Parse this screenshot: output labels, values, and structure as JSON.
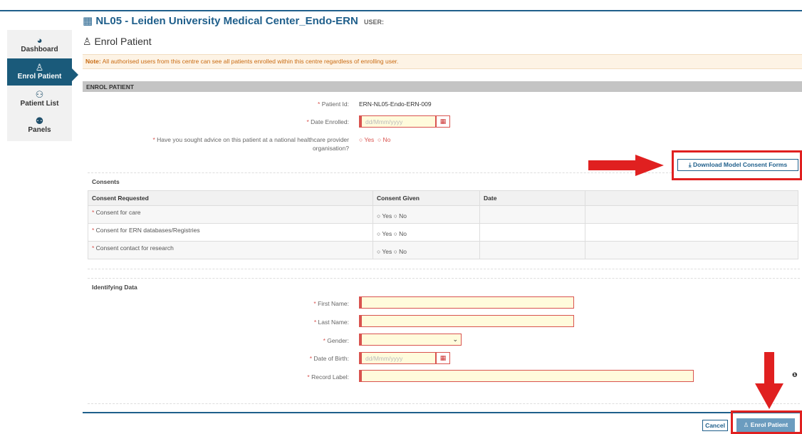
{
  "header": {
    "title": "NL05 - Leiden University Medical Center_Endo-ERN",
    "user_label": "USER:"
  },
  "sidebar": {
    "items": [
      {
        "label": "Dashboard",
        "icon": "dashboard-icon"
      },
      {
        "label": "Enrol Patient",
        "icon": "enrol-patient-icon",
        "active": true
      },
      {
        "label": "Patient List",
        "icon": "patient-list-icon"
      },
      {
        "label": "Panels",
        "icon": "panels-icon"
      }
    ]
  },
  "page": {
    "title": "Enrol Patient",
    "note_bold": "Note:",
    "note_text": "All authorised users from this centre can see all patients enrolled within this centre regardless of enrolling user.",
    "section_bar": "ENROL PATIENT"
  },
  "form": {
    "patient_id_label": "Patient Id:",
    "patient_id_value": "ERN-NL05-Endo-ERN-009",
    "date_enrolled_label": "Date Enrolled:",
    "date_placeholder": "dd/Mmm/yyyy",
    "advice_label_line1": "Have you sought advice on this patient at a national healthcare provider",
    "advice_label_line2": "organisation?",
    "yes": "Yes",
    "no": "No",
    "download_button": "Download Model Consent Forms"
  },
  "consents": {
    "section_title": "Consents",
    "columns": [
      "Consent Requested",
      "Consent Given",
      "Date",
      ""
    ],
    "rows": [
      {
        "label": "Consent for care"
      },
      {
        "label": "Consent for ERN databases/Registries"
      },
      {
        "label": "Consent contact for research"
      }
    ]
  },
  "identifying": {
    "section_title": "Identifying Data",
    "first_name_label": "First Name:",
    "last_name_label": "Last Name:",
    "gender_label": "Gender:",
    "dob_label": "Date of Birth:",
    "dob_placeholder": "dd/Mmm/yyyy",
    "record_label": "Record Label:"
  },
  "footer": {
    "cancel": "Cancel",
    "enrol": "Enrol Patient"
  },
  "colors": {
    "brand": "#1f5f8b",
    "required": "#d9534f",
    "annotation": "#e02020"
  }
}
